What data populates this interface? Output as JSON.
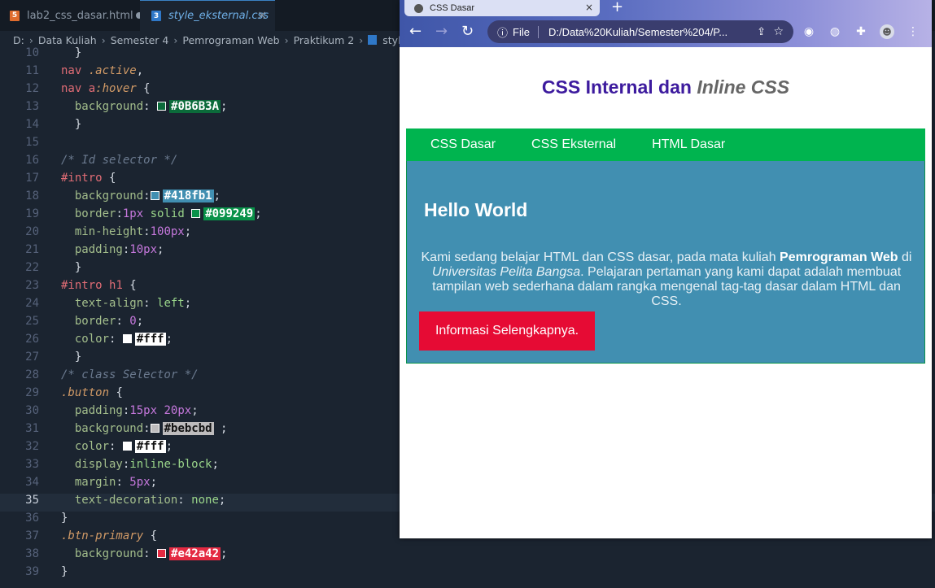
{
  "editor": {
    "tabs": [
      {
        "label": "lab2_css_dasar.html",
        "icon": "html5-icon",
        "modified": true
      },
      {
        "label": "style_eksternal.css",
        "icon": "css3-icon",
        "active": true
      }
    ],
    "breadcrumb": [
      "D:",
      "Data Kuliah",
      "Semester 4",
      "Pemrograman Web",
      "Praktikum 2",
      "style_eksternal.css"
    ],
    "current_line": 35,
    "lines": [
      {
        "n": "10"
      },
      {
        "n": "11"
      },
      {
        "n": "12"
      },
      {
        "n": "13"
      },
      {
        "n": "14"
      },
      {
        "n": "15"
      },
      {
        "n": "16"
      },
      {
        "n": "17"
      },
      {
        "n": "18"
      },
      {
        "n": "19"
      },
      {
        "n": "20"
      },
      {
        "n": "21"
      },
      {
        "n": "22"
      },
      {
        "n": "23"
      },
      {
        "n": "24"
      },
      {
        "n": "25"
      },
      {
        "n": "26"
      },
      {
        "n": "27"
      },
      {
        "n": "28"
      },
      {
        "n": "29"
      },
      {
        "n": "30"
      },
      {
        "n": "31"
      },
      {
        "n": "32"
      },
      {
        "n": "33"
      },
      {
        "n": "34"
      },
      {
        "n": "35"
      },
      {
        "n": "36"
      },
      {
        "n": "37"
      },
      {
        "n": "38"
      },
      {
        "n": "39"
      }
    ],
    "colors": {
      "c0b6b3a": "#0B6B3A",
      "c418fb1": "#418fb1",
      "c099249": "#099249",
      "cfff": "#fff",
      "cbebcbd": "#bebcbd",
      "ce42a42": "#e42a42"
    }
  },
  "browser": {
    "tab_title": "CSS Dasar",
    "address_scheme": "File",
    "address_url": "D:/Data%20Kuliah/Semester%204/P...",
    "page": {
      "title_main": "CSS Internal dan ",
      "title_italic": "Inline CSS",
      "nav": [
        "CSS Dasar",
        "CSS Eksternal",
        "HTML Dasar"
      ],
      "intro_heading": "Hello World",
      "intro_p_1": "Kami sedang belajar HTML dan CSS dasar, pada mata kuliah ",
      "intro_p_bold": "Pemrograman Web",
      "intro_p_2": " di ",
      "intro_p_italic": "Universitas Pelita Bangsa",
      "intro_p_3": ". Pelajaran pertaman yang kami dapat adalah membuat tampilan web sederhana dalam rangka mengenal tag-tag dasar dalam HTML dan CSS.",
      "button_label": "Informasi Selengkapnya."
    }
  }
}
